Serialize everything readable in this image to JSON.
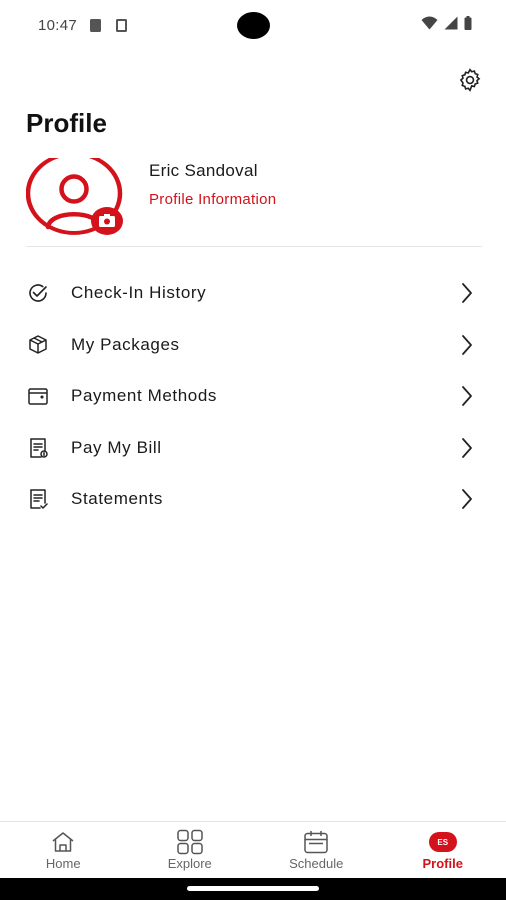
{
  "status_bar": {
    "time": "10:47",
    "icons": [
      "sim-icon",
      "notification-icon",
      "wifi-icon",
      "signal-icon",
      "battery-icon"
    ]
  },
  "header": {
    "title": "Profile",
    "settings_icon": "gear-icon"
  },
  "profile": {
    "name": "Eric Sandoval",
    "info_link": "Profile Information",
    "avatar_icon": "user-avatar-icon",
    "camera_icon": "camera-icon"
  },
  "menu": {
    "items": [
      {
        "label": "Check-In History",
        "icon": "check-circle-icon"
      },
      {
        "label": "My Packages",
        "icon": "package-icon"
      },
      {
        "label": "Payment Methods",
        "icon": "wallet-icon"
      },
      {
        "label": "Pay My Bill",
        "icon": "bill-icon"
      },
      {
        "label": "Statements",
        "icon": "statement-icon"
      }
    ]
  },
  "bottom_nav": {
    "items": [
      {
        "label": "Home",
        "icon": "home-icon",
        "active": false
      },
      {
        "label": "Explore",
        "icon": "grid-icon",
        "active": false
      },
      {
        "label": "Schedule",
        "icon": "calendar-icon",
        "active": false
      },
      {
        "label": "Profile",
        "badge": "ES",
        "active": true
      }
    ]
  },
  "colors": {
    "accent": "#d3121b",
    "text": "#1a1a1a",
    "muted": "#666666",
    "divider": "#e6e6e6"
  }
}
